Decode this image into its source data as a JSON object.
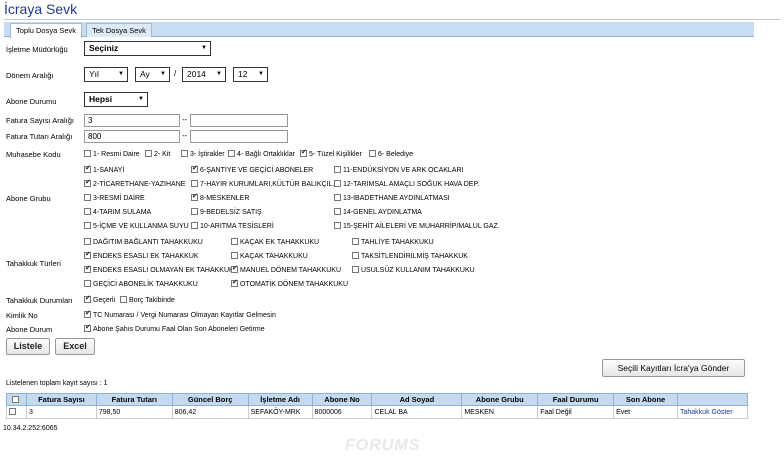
{
  "page": {
    "title": "İcraya Sevk"
  },
  "tabs": [
    {
      "label": "Toplu Dosya Sevk",
      "active": true
    },
    {
      "label": "Tek Dosya Sevk",
      "active": false
    }
  ],
  "form": {
    "isletme_label": "İşletme Müdürlüğü",
    "isletme_value": "Seçiniz",
    "donem_label": "Dönem Aralığı",
    "donem_yil1": "Yıl",
    "donem_ay1": "Ay",
    "donem_sep": "/",
    "donem_yil2": "2014",
    "donem_ay2": "12",
    "abone_durumu_label": "Abone Durumu",
    "abone_durumu_value": "Hepsi",
    "fatura_sayisi_label": "Fatura Sayısı Aralığı",
    "fatura_sayisi_min": "3",
    "fatura_sayisi_max": "",
    "fatura_tutari_label": "Fatura Tutarı Aralığı",
    "fatura_tutari_min": "800",
    "fatura_tutari_max": "",
    "range_sep": "--",
    "muhasebe_label": "Muhasebe Kodu",
    "muhasebe_options": [
      {
        "label": "1- Resmi Daire",
        "checked": false
      },
      {
        "label": "2- Kit",
        "checked": false
      },
      {
        "label": "3- İştirakler",
        "checked": false
      },
      {
        "label": "4- Bağlı Ortaklıklar",
        "checked": false
      },
      {
        "label": "5- Tüzel Kişilikler",
        "checked": true
      },
      {
        "label": "6- Belediye",
        "checked": false
      }
    ],
    "abone_grubu_label": "Abone Grubu",
    "abone_grubu_options": [
      {
        "label": "1-SANAYİ",
        "checked": true
      },
      {
        "label": "6-ŞANTİYE VE GEÇİCİ ABONELER",
        "checked": true
      },
      {
        "label": "11-ENDÜKSİYON VE ARK OCAKLARI",
        "checked": false
      },
      {
        "label": "2-TİCARETHANE-YAZIHANE",
        "checked": true
      },
      {
        "label": "7-HAYIR KURUMLARI,KÜLTÜR BALIKÇIL..",
        "checked": false
      },
      {
        "label": "12-TARIMSAL AMAÇLI SOĞUK HAVA DEP.",
        "checked": false
      },
      {
        "label": "3-RESMİ DAİRE",
        "checked": false
      },
      {
        "label": "8-MESKENLER",
        "checked": true
      },
      {
        "label": "13-İBADETHANE AYDINLATMASI",
        "checked": false
      },
      {
        "label": "4-TARIM SULAMA",
        "checked": false
      },
      {
        "label": "9-BEDELSİZ SATIŞ",
        "checked": false
      },
      {
        "label": "14-GENEL AYDINLATMA",
        "checked": false
      },
      {
        "label": "5-İÇME VE KULLANMA SUYU",
        "checked": false
      },
      {
        "label": "10-ARITMA TESİSLERİ",
        "checked": false
      },
      {
        "label": "15-ŞEHİT AİLELERİ VE MUHARRİP/MALUL GAZ.",
        "checked": false
      }
    ],
    "tahakkuk_turleri_label": "Tahakkuk Türleri",
    "tahakkuk_turleri_options": [
      {
        "label": "DAĞITIM BAĞLANTI TAHAKKUKU",
        "checked": false
      },
      {
        "label": "KAÇAK EK TAHAKKUKU",
        "checked": false
      },
      {
        "label": "TAHLİYE TAHAKKUKU",
        "checked": false
      },
      {
        "label": "ENDEKS ESASLI EK TAHAKKUK",
        "checked": true
      },
      {
        "label": "KAÇAK TAHAKKUKU",
        "checked": false
      },
      {
        "label": "TAKSİTLENDİRİLMİŞ TAHAKKUK",
        "checked": false
      },
      {
        "label": "ENDEKS ESASLI OLMAYAN EK TAHAKKUK",
        "checked": true
      },
      {
        "label": "MANUEL DÖNEM TAHAKKUKU",
        "checked": true
      },
      {
        "label": "USULSÜZ KULLANIM TAHAKKUKU",
        "checked": false
      },
      {
        "label": "GEÇİCİ ABONELİK TAHAKKUKU",
        "checked": false
      },
      {
        "label": "OTOMATİK DÖNEM TAHAKKUKU",
        "checked": true
      }
    ],
    "tahakkuk_durumlari_label": "Tahakkuk Durumları",
    "tahakkuk_durumlari_options": [
      {
        "label": "Geçerli",
        "checked": true
      },
      {
        "label": "Borç Takibinde",
        "checked": false
      }
    ],
    "kimlik_label": "Kimlik No",
    "kimlik_option": {
      "label": "TC Numarası / Vergi Numarası Olmayan Kayıtlar Gelmesin",
      "checked": true
    },
    "abone_durum_label": "Abone Durum",
    "abone_durum_option": {
      "label": "Abone Şahıs Durumu Faal Olan Son Aboneleri Getirme",
      "checked": true
    }
  },
  "buttons": {
    "listele": "Listele",
    "excel": "Excel",
    "send": "Seçili Kayıtları İcra'ya Gönder"
  },
  "results": {
    "count_text": "Listelenen toplam kayıt sayısı : 1",
    "columns": [
      "",
      "Fatura Sayısı",
      "Fatura Tutarı",
      "Güncel Borç",
      "İşletme Adı",
      "Abone No",
      "Ad Soyad",
      "Abone Grubu",
      "Faal Durumu",
      "Son Abone",
      ""
    ],
    "rows": [
      {
        "checked": false,
        "fatura_sayisi": "3",
        "fatura_tutari": "798,50",
        "guncel_borc": "806,42",
        "isletme_adi": "SEFAKÖY-MRK",
        "abone_no": "8000006",
        "ad_soyad": "CELAL BA",
        "abone_grubu": "MESKEN",
        "faal_durumu": "Faal Değil",
        "son_abone": "Evet",
        "action": "Tahakkuk Göster"
      }
    ]
  },
  "footer": {
    "ip": "10.34.2.252:6065",
    "watermark": "FORUMS"
  },
  "colors": {
    "title": "#1f3a93",
    "tab_bar": "#c9ddf2",
    "header": "#c5d9ef"
  }
}
